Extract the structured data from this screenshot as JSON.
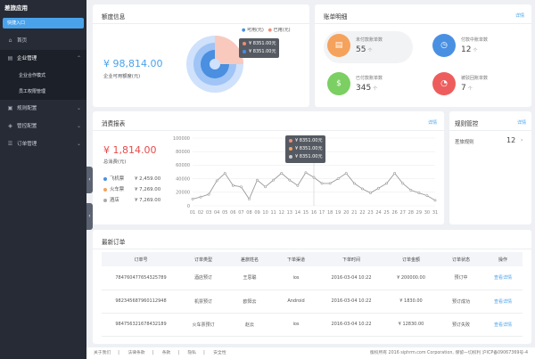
{
  "app": {
    "title": "差旅应用",
    "quick_entry": "快捷入口"
  },
  "sidebar": {
    "items": [
      {
        "label": "首页"
      },
      {
        "label": "企业管理"
      },
      {
        "label": "企业合作模式"
      },
      {
        "label": "员工权限管理"
      },
      {
        "label": "规则配置"
      },
      {
        "label": "管控配置"
      },
      {
        "label": "订单管理"
      }
    ]
  },
  "credit": {
    "title": "额度信息",
    "amount": "¥ 98,814.00",
    "amount_label": "企业可用额度(元)",
    "legend_available": "可用(元)",
    "legend_used": "已用(元)",
    "tooltip": [
      "¥ 8351.00元",
      "¥ 8351.00元"
    ],
    "donut": {
      "available": 75,
      "used": 25
    },
    "colors": {
      "available": "#4a8fe0",
      "used": "#f08c7a"
    }
  },
  "bills": {
    "title": "账单明细",
    "link": "详情",
    "items": [
      {
        "label": "未付款账单数",
        "value": "55",
        "unit": "个",
        "color": "#f5a25d",
        "icon": "document-icon"
      },
      {
        "label": "付款中账单数",
        "value": "12",
        "unit": "个",
        "color": "#4a90e2",
        "icon": "clock-icon"
      },
      {
        "label": "已付款账单数",
        "value": "345",
        "unit": "个",
        "color": "#7ccf62",
        "icon": "money-bag-icon"
      },
      {
        "label": "被驳回账单数",
        "value": "7",
        "unit": "个",
        "color": "#ee5d5d",
        "icon": "speedometer-icon"
      }
    ]
  },
  "consumption": {
    "title": "消费报表",
    "link": "详情",
    "amount": "¥ 1,814.00",
    "amount_label": "总消费(元)",
    "breakdown": [
      {
        "label": "飞机票",
        "value": "¥ 2,459.00",
        "color": "#4a90e2"
      },
      {
        "label": "火车票",
        "value": "¥ 7,269.00",
        "color": "#f5a25d"
      },
      {
        "label": "酒店",
        "value": "¥ 7,269.00",
        "color": "#aaaaaa"
      }
    ],
    "tooltip": [
      {
        "value": "¥ 8351.00元",
        "color": "#f08c7a"
      },
      {
        "value": "¥ 8351.00元",
        "color": "#f5a25d"
      },
      {
        "value": "¥ 8351.00元",
        "color": "#cccccc"
      }
    ]
  },
  "chart_data": {
    "type": "line",
    "title": "",
    "xlabel": "",
    "ylabel": "",
    "x": [
      "01",
      "02",
      "03",
      "04",
      "05",
      "06",
      "07",
      "08",
      "09",
      "10",
      "11",
      "12",
      "13",
      "14",
      "15",
      "16",
      "17",
      "18",
      "19",
      "20",
      "21",
      "22",
      "23",
      "24",
      "25",
      "26",
      "27",
      "28",
      "29",
      "30",
      "31"
    ],
    "y_ticks": [
      0,
      20000,
      40000,
      60000,
      80000,
      100000
    ],
    "ylim": [
      0,
      100000
    ],
    "values": [
      10000,
      13000,
      17000,
      37000,
      48000,
      30000,
      28000,
      10000,
      38000,
      28000,
      38000,
      48000,
      38000,
      30000,
      49000,
      42000,
      33000,
      33000,
      40000,
      48000,
      33000,
      25000,
      19000,
      26000,
      33000,
      48000,
      33000,
      23000,
      19000,
      15000,
      8000
    ],
    "grid": true,
    "color": "#9a9a9a"
  },
  "rules": {
    "title": "规则管控",
    "link": "详情",
    "label": "差旅规则",
    "value": "12"
  },
  "orders": {
    "title": "最新订单",
    "columns": [
      "订单号",
      "订单类型",
      "差旅姓名",
      "下单渠道",
      "下单时间",
      "订单金额",
      "订单状态",
      "操作"
    ],
    "rows": [
      [
        "784760477654325789",
        "酒店预订",
        "王思聪",
        "ios",
        "2016-03-04 10:22",
        "¥ 200000.00",
        "预订中",
        "查看详情"
      ],
      [
        "982345687960112948",
        "机票预订",
        "欧阳云",
        "Android",
        "2016-03-04 10:22",
        "¥ 1830.00",
        "预订成功",
        "查看详情"
      ],
      [
        "984756321678432189",
        "火车票预订",
        "赵云",
        "ios",
        "2016-03-04 10:22",
        "¥ 12830.00",
        "预订失败",
        "查看详情"
      ]
    ]
  },
  "footer": {
    "links": [
      "关于我们",
      "法律条款",
      "条款",
      "隐私",
      "安全性"
    ],
    "copyright": "版权所有 2016 siphrm.com Corporation, 保留一切权利 沪ICP备09067369号-4"
  }
}
